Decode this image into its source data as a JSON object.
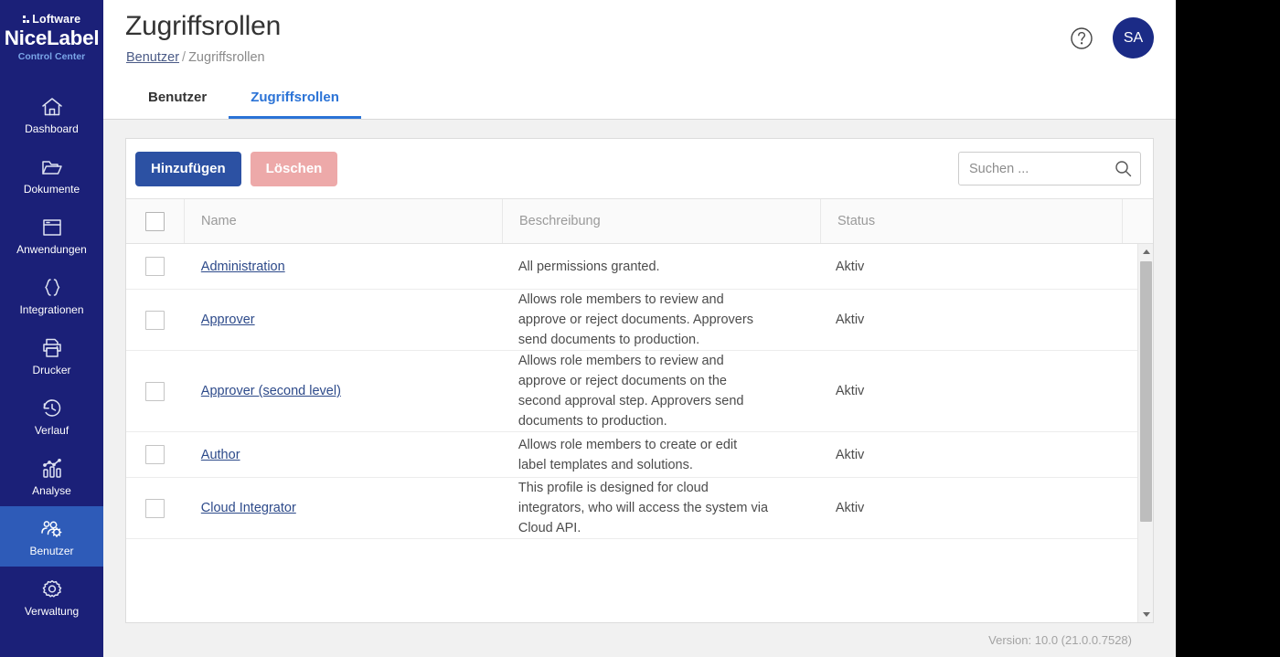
{
  "brand": {
    "loftware": "Loftware",
    "nicelabel": "NiceLabel",
    "control_center": "Control Center",
    "sidebar_bg": "#1b2078",
    "sidebar_active_bg": "#2e5bb8",
    "accent": "#2b73d6"
  },
  "sidebar": {
    "items": [
      {
        "label": "Dashboard",
        "icon": "home-icon",
        "active": false
      },
      {
        "label": "Dokumente",
        "icon": "folder-icon",
        "active": false
      },
      {
        "label": "Anwendungen",
        "icon": "window-icon",
        "active": false
      },
      {
        "label": "Integrationen",
        "icon": "braces-icon",
        "active": false
      },
      {
        "label": "Drucker",
        "icon": "printer-icon",
        "active": false
      },
      {
        "label": "Verlauf",
        "icon": "history-clock-icon",
        "active": false
      },
      {
        "label": "Analyse",
        "icon": "bar-chart-icon",
        "active": false
      },
      {
        "label": "Benutzer",
        "icon": "users-gear-icon",
        "active": true
      },
      {
        "label": "Verwaltung",
        "icon": "gear-icon",
        "active": false
      }
    ]
  },
  "header": {
    "title": "Zugriffsrollen",
    "breadcrumb": {
      "parent": "Benutzer",
      "separator": "/",
      "current": "Zugriffsrollen"
    },
    "help_icon": "question-circle-icon",
    "avatar_initials": "SA"
  },
  "tabs": [
    {
      "label": "Benutzer",
      "active": false
    },
    {
      "label": "Zugriffsrollen",
      "active": true
    }
  ],
  "toolbar": {
    "add_label": "Hinzufügen",
    "delete_label": "Löschen",
    "add_color": "#2c51a3",
    "delete_color": "#eda9a9"
  },
  "search": {
    "placeholder": "Suchen ...",
    "value": "",
    "icon": "search-icon"
  },
  "table": {
    "columns": [
      "Name",
      "Beschreibung",
      "Status"
    ],
    "rows": [
      {
        "name": "Administration",
        "description": "All permissions granted.",
        "description_lines": [
          "All permissions granted."
        ],
        "status": "Aktiv",
        "checked": false
      },
      {
        "name": "Approver",
        "description": "Allows role members to review and approve or reject documents. Approvers send documents to production.",
        "description_lines": [
          "Allows role members to review and",
          "approve or reject documents. Approvers",
          "send documents to production."
        ],
        "status": "Aktiv",
        "checked": false
      },
      {
        "name": "Approver (second level)",
        "description": "Allows role members to review and approve or reject documents on the second approval step. Approvers send documents to production.",
        "description_lines": [
          "Allows role members to review and",
          "approve or reject documents on the",
          "second approval step. Approvers send",
          "documents to production."
        ],
        "status": "Aktiv",
        "checked": false
      },
      {
        "name": "Author",
        "description": "Allows role members to create or edit label templates and solutions.",
        "description_lines": [
          "Allows role members to create or edit",
          "label templates and solutions."
        ],
        "status": "Aktiv",
        "checked": false
      },
      {
        "name": "Cloud Integrator",
        "description": "This profile is designed for cloud integrators, who will access the system via Cloud API.",
        "description_lines": [
          "This profile is designed for cloud",
          "integrators, who will access the system via",
          "Cloud API."
        ],
        "status": "Aktiv",
        "checked": false
      }
    ]
  },
  "footer": {
    "version": "Version: 10.0 (21.0.0.7528)"
  }
}
